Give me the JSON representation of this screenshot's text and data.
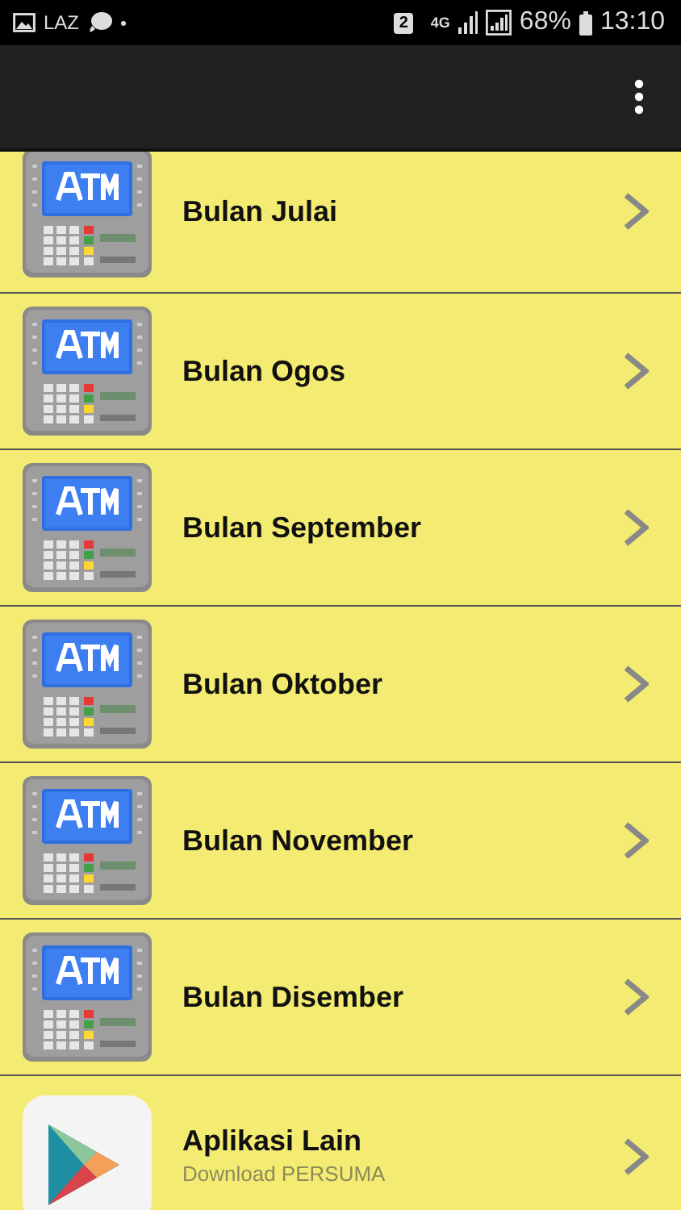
{
  "status_bar": {
    "notification_text": "LAZ",
    "sim_slot": "2",
    "network": "4G",
    "battery": "68%",
    "time": "13:10"
  },
  "items": [
    {
      "kind": "atm",
      "title": "Bulan Julai"
    },
    {
      "kind": "atm",
      "title": "Bulan Ogos"
    },
    {
      "kind": "atm",
      "title": "Bulan September"
    },
    {
      "kind": "atm",
      "title": "Bulan Oktober"
    },
    {
      "kind": "atm",
      "title": "Bulan November"
    },
    {
      "kind": "atm",
      "title": "Bulan Disember"
    },
    {
      "kind": "app",
      "title": "Aplikasi Lain",
      "subtitle": "Download PERSUMA"
    }
  ]
}
